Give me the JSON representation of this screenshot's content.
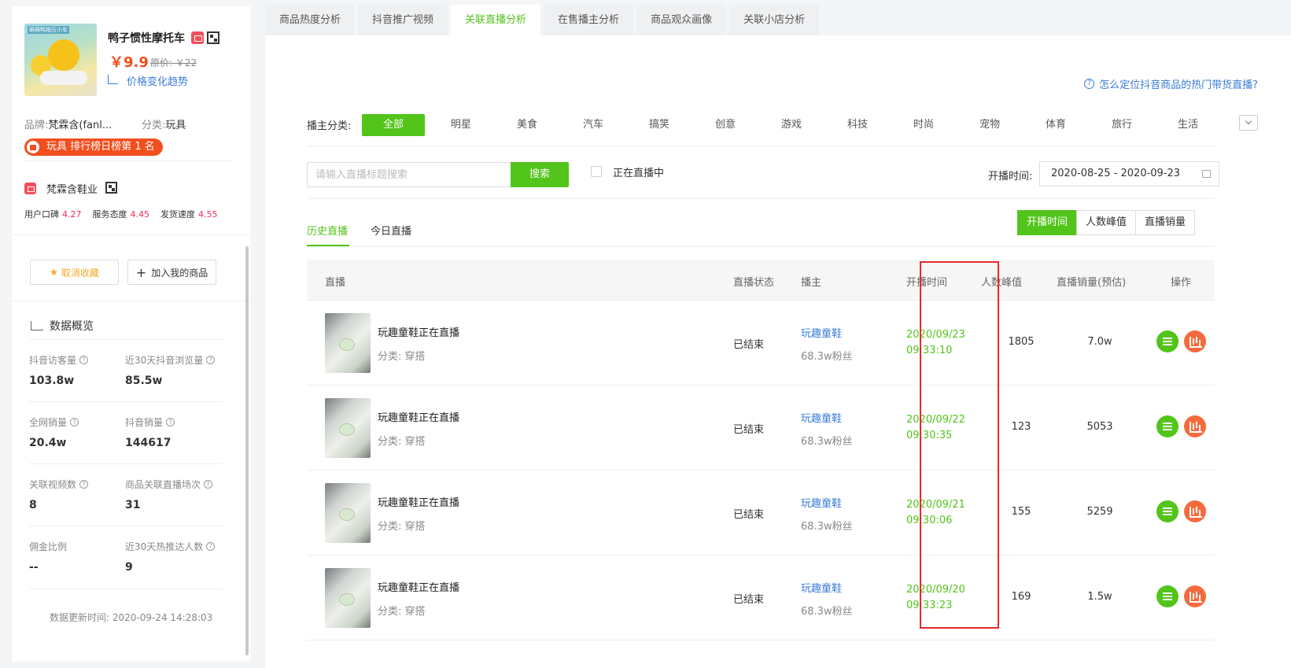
{
  "product": {
    "img_tag": "萌萌鸭按压小车",
    "title": "鸭子惯性摩托车",
    "price": "￥9.9",
    "orig_price": "原价: ￥22",
    "trend_link": "价格变化趋势",
    "brand_label": "品牌:",
    "brand_value": "梵霖含(fanl...",
    "category_label": "分类:",
    "category_value": "玩具",
    "rank_badge": "玩具 排行榜日榜第 1 名"
  },
  "store": {
    "name": "梵霖含鞋业",
    "scores": [
      {
        "label": "用户口碑",
        "value": "4.27"
      },
      {
        "label": "服务态度",
        "value": "4.45"
      },
      {
        "label": "发货速度",
        "value": "4.55"
      }
    ]
  },
  "actions": {
    "unfavorite": "取消收藏",
    "add_mine": "加入我的商品"
  },
  "overview": {
    "title": "数据概览",
    "stats": [
      {
        "label": "抖音访客量",
        "value": "103.8w"
      },
      {
        "label": "近30天抖音浏览量",
        "value": "85.5w"
      },
      {
        "label": "全网销量",
        "value": "20.4w"
      },
      {
        "label": "抖音销量",
        "value": "144617"
      },
      {
        "label": "关联视频数",
        "value": "8"
      },
      {
        "label": "商品关联直播场次",
        "value": "31"
      },
      {
        "label": "佣金比例",
        "value": "--"
      },
      {
        "label": "近30天热推达人数",
        "value": "9"
      }
    ],
    "update_time": "数据更新时间: 2020-09-24 14:28:03"
  },
  "tabs": [
    {
      "label": "商品热度分析"
    },
    {
      "label": "抖音推广视频"
    },
    {
      "label": "关联直播分析"
    },
    {
      "label": "在售播主分析"
    },
    {
      "label": "商品观众画像"
    },
    {
      "label": "关联小店分析"
    }
  ],
  "help_link": "怎么定位抖音商品的热门带货直播?",
  "filter": {
    "label": "播主分类:",
    "categories": [
      "全部",
      "明星",
      "美食",
      "汽车",
      "搞笑",
      "创意",
      "游戏",
      "科技",
      "时尚",
      "宠物",
      "体育",
      "旅行",
      "生活"
    ]
  },
  "search": {
    "placeholder": "请输入直播标题搜索",
    "button": "搜索",
    "live_now": "正在直播中",
    "date_label": "开播时间:",
    "date_range": "2020-08-25 - 2020-09-23"
  },
  "subtabs": [
    "历史直播",
    "今日直播"
  ],
  "sort_buttons": [
    "开播时间",
    "人数峰值",
    "直播销量"
  ],
  "table": {
    "headers": [
      "直播",
      "直播状态",
      "播主",
      "开播时间",
      "人数峰值",
      "直播销量(预估)",
      "操作"
    ],
    "rows": [
      {
        "title": "玩趣童鞋正在直播",
        "category": "分类: 穿搭",
        "status": "已结束",
        "streamer": "玩趣童鞋",
        "fans": "68.3w粉丝",
        "date": "2020/09/23",
        "time": "09:33:10",
        "peak": "1805",
        "sales": "7.0w"
      },
      {
        "title": "玩趣童鞋正在直播",
        "category": "分类: 穿搭",
        "status": "已结束",
        "streamer": "玩趣童鞋",
        "fans": "68.3w粉丝",
        "date": "2020/09/22",
        "time": "09:30:35",
        "peak": "123",
        "sales": "5053"
      },
      {
        "title": "玩趣童鞋正在直播",
        "category": "分类: 穿搭",
        "status": "已结束",
        "streamer": "玩趣童鞋",
        "fans": "68.3w粉丝",
        "date": "2020/09/21",
        "time": "09:30:06",
        "peak": "155",
        "sales": "5259"
      },
      {
        "title": "玩趣童鞋正在直播",
        "category": "分类: 穿搭",
        "status": "已结束",
        "streamer": "玩趣童鞋",
        "fans": "68.3w粉丝",
        "date": "2020/09/20",
        "time": "09:33:23",
        "peak": "169",
        "sales": "1.5w"
      }
    ]
  },
  "colors": {
    "accent": "#52c41a",
    "link": "#3a7cd6",
    "price": "#f24e1e",
    "highlight_box": "#e52b2b"
  }
}
